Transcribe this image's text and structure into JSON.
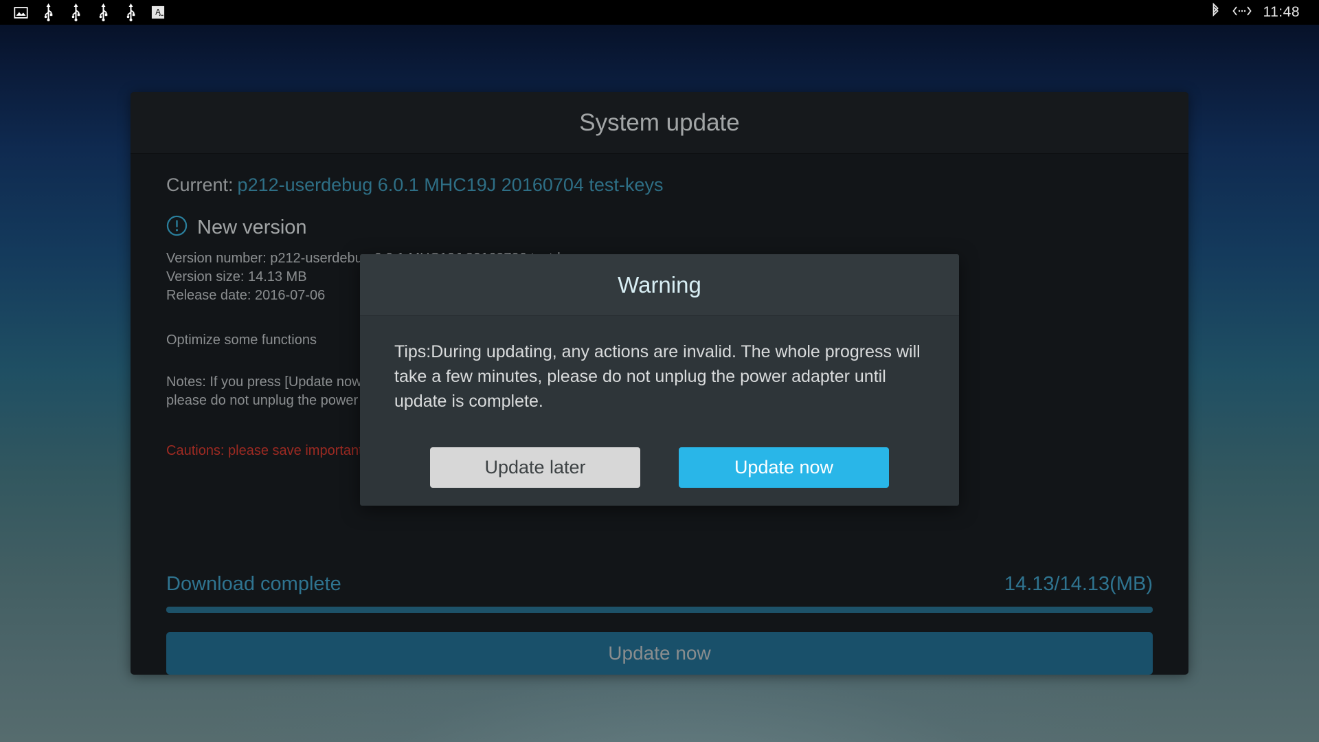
{
  "statusbar": {
    "left_icons": [
      {
        "name": "image-icon",
        "glyph": "picture"
      },
      {
        "name": "usb-icon-1",
        "glyph": "usb"
      },
      {
        "name": "usb-icon-2",
        "glyph": "usb"
      },
      {
        "name": "usb-icon-3",
        "glyph": "usb"
      },
      {
        "name": "usb-icon-4",
        "glyph": "usb"
      },
      {
        "name": "keyboard-input-icon",
        "glyph": "A"
      }
    ],
    "right_icons": [
      {
        "name": "bluetooth-icon",
        "glyph": "bluetooth"
      },
      {
        "name": "ethernet-icon",
        "glyph": "ethernet"
      }
    ],
    "clock": "11:48"
  },
  "card": {
    "title": "System update",
    "current_label": "Current:",
    "current_value": "p212-userdebug 6.0.1 MHC19J 20160704 test-keys",
    "new_version_label": "New version",
    "new_version_icon": "exclamation-circle-icon",
    "version_number": "Version number: p212-userdebug 6.0.1 MHC19J 20160706 test-keys",
    "version_size": "Version size: 14.13 MB",
    "release_date": "Release date: 2016-07-06",
    "optimize_text": "Optimize some functions",
    "notes_line1": "Notes: If you press [Update now], the whole progress will take a few minutes,",
    "notes_line2": "please do not unplug the power adapter until update is complete.",
    "cautions_text": "Cautions: please save important data before update",
    "progress_status": "Download complete",
    "progress_amount": "14.13/14.13(MB)",
    "progress_percent": 100,
    "update_now_label": "Update now"
  },
  "dialog": {
    "title": "Warning",
    "message": "Tips:During updating, any actions are invalid. The whole progress will take a few minutes, please do not unplug the power adapter until update is complete.",
    "update_later_label": "Update later",
    "update_now_label": "Update now"
  },
  "colors": {
    "accent_blue": "#29b6e8",
    "muted_blue": "#2f7490",
    "caution_red": "#9d2a22",
    "dialog_bg": "#2e3539",
    "card_bg": "#121518"
  }
}
